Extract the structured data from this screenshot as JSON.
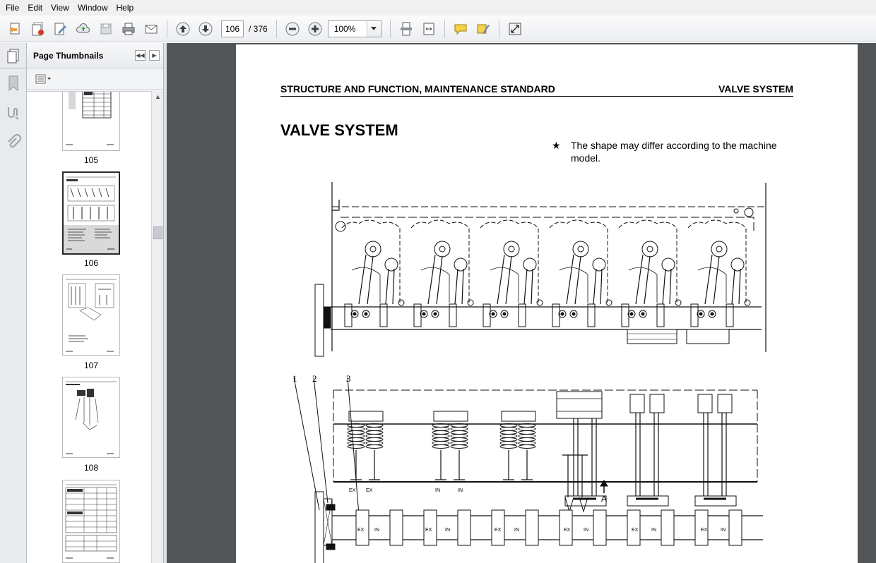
{
  "menu": [
    "File",
    "Edit",
    "View",
    "Window",
    "Help"
  ],
  "toolbar": {
    "current_page": "106",
    "page_total": "/ 376",
    "zoom": "100%",
    "icons": [
      "create-pdf-icon",
      "combine-files-icon",
      "edit-document-icon",
      "upload-cloud-icon",
      "save-icon",
      "print-icon",
      "email-icon",
      "previous-page-icon",
      "next-page-icon",
      "zoom-out-icon",
      "zoom-in-icon",
      "fit-page-icon",
      "fit-width-icon",
      "comment-icon",
      "highlight-icon",
      "full-screen-icon"
    ]
  },
  "navrail": {
    "icons": [
      "page-thumbnails-icon",
      "bookmarks-icon",
      "signatures-icon",
      "attachments-icon"
    ]
  },
  "thumbnails": {
    "title": "Page Thumbnails",
    "pages": [
      "105",
      "106",
      "107",
      "108",
      ""
    ],
    "selected": "106"
  },
  "document": {
    "header_left": "STRUCTURE AND FUNCTION, MAINTENANCE STANDARD",
    "header_right": "VALVE SYSTEM",
    "title": "VALVE SYSTEM",
    "note_star": "★",
    "note": "The shape may differ according to the machine model.",
    "callouts": [
      "1",
      "2",
      "3"
    ],
    "arrow_label": "A",
    "valve_labels": [
      "EX",
      "EX",
      "IN",
      "IN"
    ],
    "shaft_labels": [
      "EX",
      "IN",
      "EX",
      "IN",
      "EX",
      "IN",
      "EX",
      "IN",
      "EX",
      "IN",
      "EX",
      "IN"
    ]
  },
  "colors": {
    "doc_background": "#525659",
    "panel_background": "#f3f4f6",
    "selected_thumb": "#d9d9d9"
  }
}
